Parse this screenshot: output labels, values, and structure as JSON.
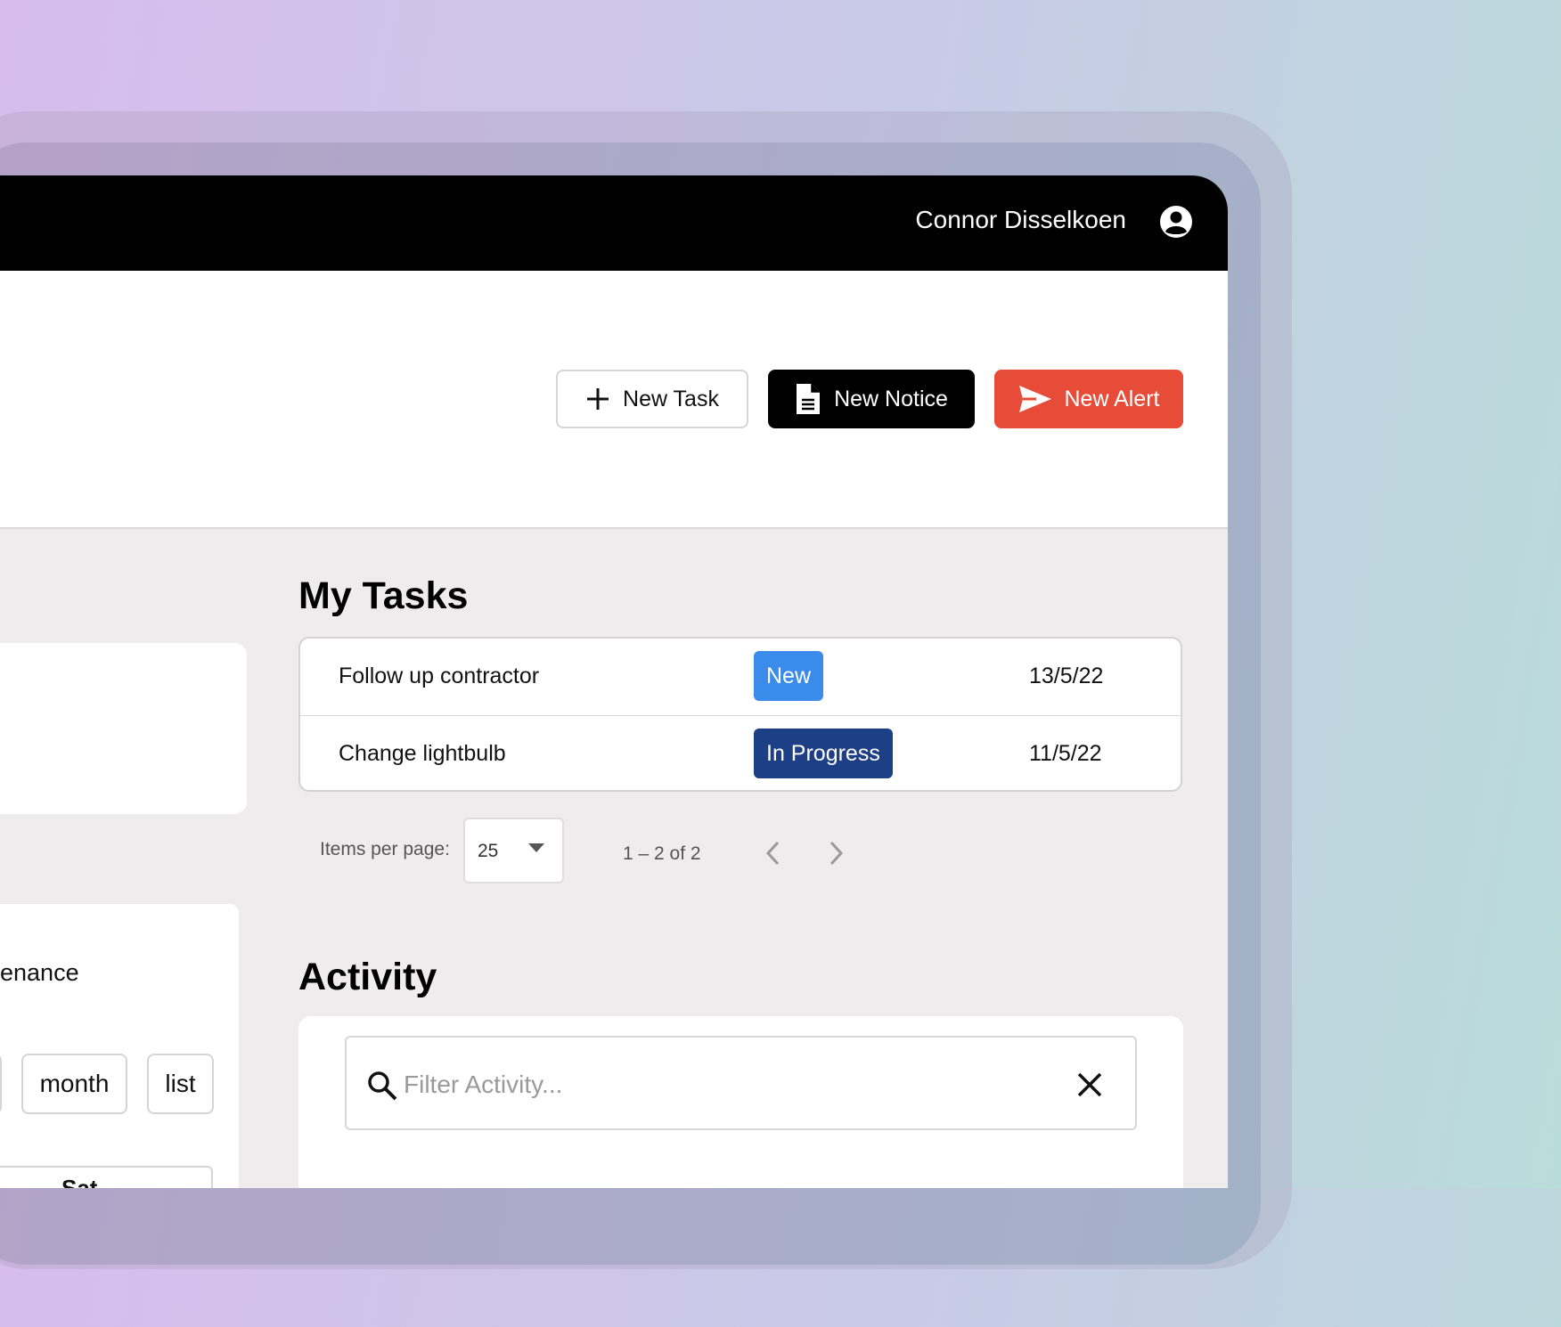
{
  "header": {
    "user_name": "Connor Disselkoen"
  },
  "toolbar": {
    "new_task_label": "New Task",
    "new_notice_label": "New Notice",
    "new_alert_label": "New Alert"
  },
  "left_panel": {
    "maintenance_text_fragment": "enance",
    "view_buttons": [
      "month",
      "list"
    ],
    "calendar_day_header": "Sat"
  },
  "tasks": {
    "title": "My Tasks",
    "rows": [
      {
        "name": "Follow up contractor",
        "status": "New",
        "status_color": "#3b8beb",
        "date": "13/5/22"
      },
      {
        "name": "Change lightbulb",
        "status": "In Progress",
        "status_color": "#1c3f86",
        "date": "11/5/22"
      }
    ]
  },
  "paginator": {
    "items_per_page_label": "Items per page:",
    "items_per_page_value": "25",
    "range_label": "1 – 2 of 2"
  },
  "activity": {
    "title": "Activity",
    "filter_placeholder": "Filter Activity..."
  },
  "colors": {
    "alert_red": "#e64c38",
    "topbar_black": "#000000"
  }
}
